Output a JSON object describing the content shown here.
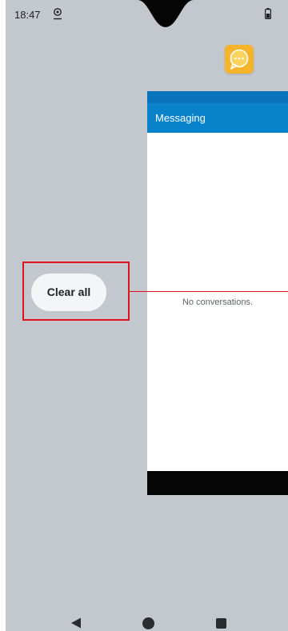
{
  "status_bar": {
    "time": "18:47",
    "location_icon": "location-pin-icon",
    "battery_icon": "battery-icon"
  },
  "recents": {
    "app_icon": "messaging-bubble-icon",
    "card": {
      "title": "Messaging",
      "overflow_glyph": "⋮",
      "empty_text": "No conversations."
    },
    "clear_all_label": "Clear all"
  },
  "navigation": {
    "back_icon": "back-triangle-icon",
    "home_icon": "home-circle-icon",
    "recents_icon": "recents-square-icon"
  },
  "colors": {
    "background": "#c3c8ce",
    "app_bar": "#0782cb",
    "highlight": "#e0121b"
  }
}
